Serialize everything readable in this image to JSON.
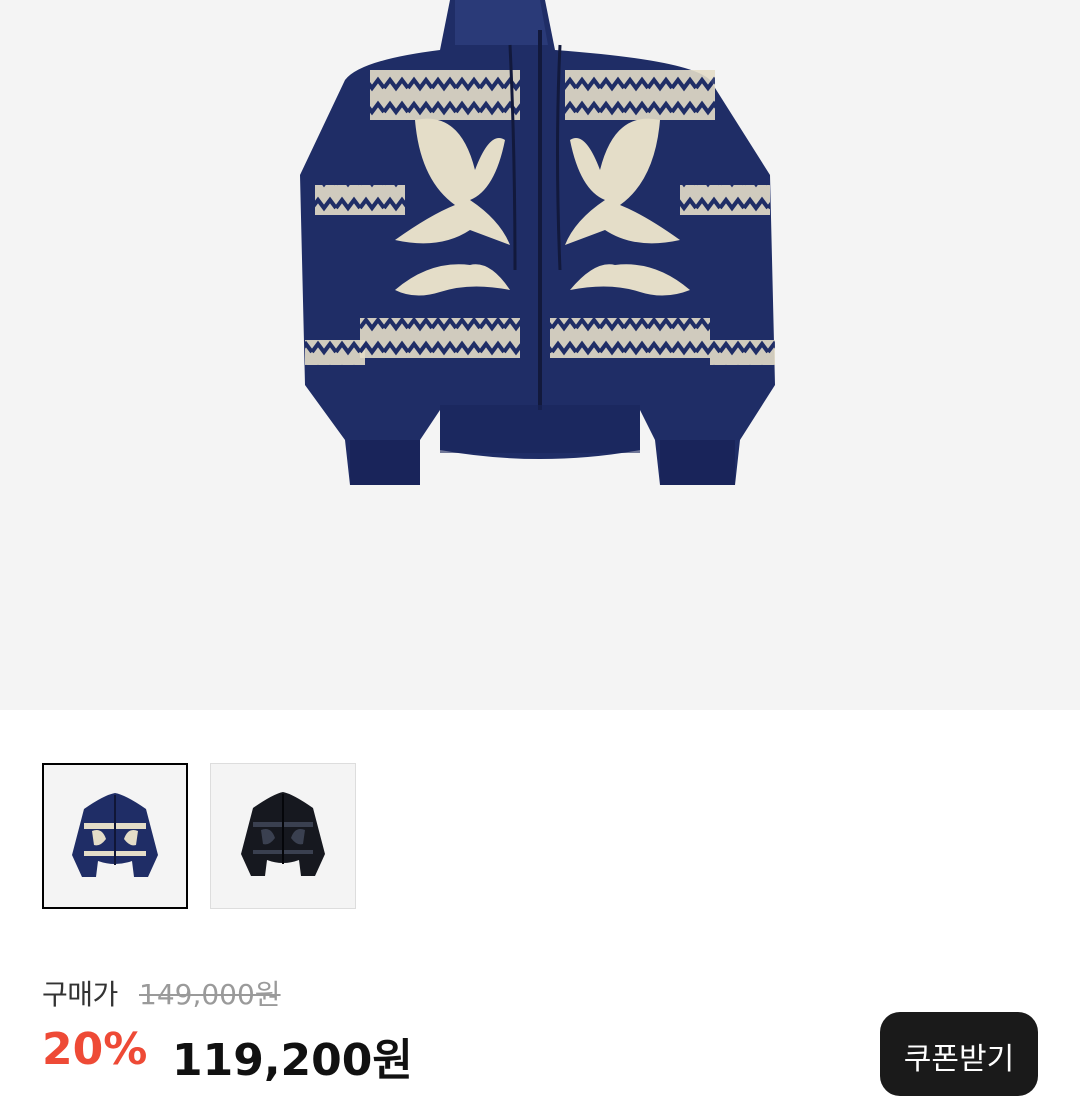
{
  "product": {
    "main_image": "navy-knit-hooded-zip-cardigan-image",
    "thumbnails": [
      {
        "name": "navy-colorway",
        "color": "#1f2d66",
        "selected": true
      },
      {
        "name": "black-colorway",
        "color": "#16181f",
        "selected": false
      }
    ]
  },
  "price": {
    "label": "구매가",
    "original": "149,000원",
    "discount": "20%",
    "sale": "119,200원"
  },
  "coupon": {
    "label": "쿠폰받기"
  },
  "colors": {
    "discount": "#ee4a36",
    "button_bg": "#1a1a1a",
    "navy": "#1f2d66",
    "cream": "#e4ddc8"
  }
}
